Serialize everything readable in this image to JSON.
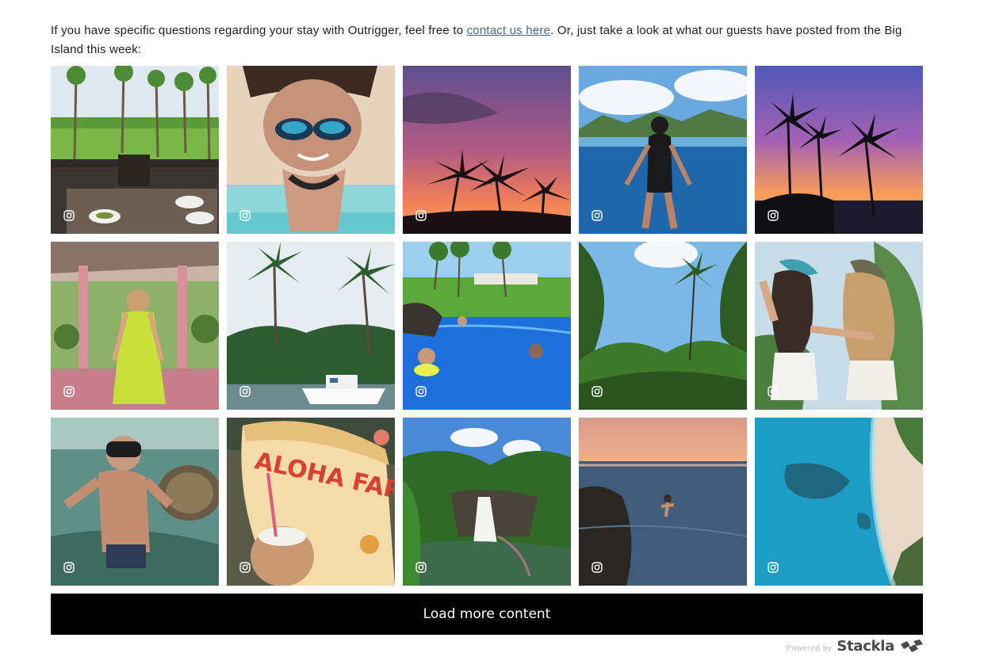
{
  "intro": {
    "text_before": "If you have specific questions regarding your stay with Outrigger, feel free to ",
    "link_text": "contact us here",
    "text_after": ". Or, just take a look at what our guests have posted from the Big Island this week:"
  },
  "gallery": {
    "tiles": [
      {
        "subject": "Patio table overlooking palm lawn",
        "source_icon": "instagram-icon"
      },
      {
        "subject": "Woman in mirrored sunglasses on beach",
        "source_icon": "instagram-icon"
      },
      {
        "subject": "Sunset palms silhouette",
        "source_icon": "instagram-icon"
      },
      {
        "subject": "Swimmer half underwater by mountains",
        "source_icon": "instagram-icon"
      },
      {
        "subject": "Palm trees at purple sunset",
        "source_icon": "instagram-icon"
      },
      {
        "subject": "Woman in green dress on pink porch",
        "source_icon": "instagram-icon"
      },
      {
        "subject": "Palm trees and boat in harbor",
        "source_icon": "instagram-icon"
      },
      {
        "subject": "Kids swimming in resort pool",
        "source_icon": "instagram-icon"
      },
      {
        "subject": "Lush jungle under blue sky",
        "source_icon": "instagram-icon"
      },
      {
        "subject": "Two women with caps hugging",
        "source_icon": "instagram-icon"
      },
      {
        "subject": "Snorkeler with sea turtle",
        "source_icon": "instagram-icon"
      },
      {
        "subject": "Aloha Farm sign with coconut drink",
        "source_icon": "instagram-icon"
      },
      {
        "subject": "Rainbow Falls waterfall",
        "source_icon": "instagram-icon"
      },
      {
        "subject": "Cliff jumper into ocean at dusk",
        "source_icon": "instagram-icon"
      },
      {
        "subject": "Aerial view of turquoise coast",
        "source_icon": "instagram-icon"
      }
    ],
    "aloha_sign_text": "ALOHA FARM"
  },
  "load_more": {
    "label": "Load more content"
  },
  "footer": {
    "powered_by": "Powered by",
    "brand": "Stackla"
  }
}
